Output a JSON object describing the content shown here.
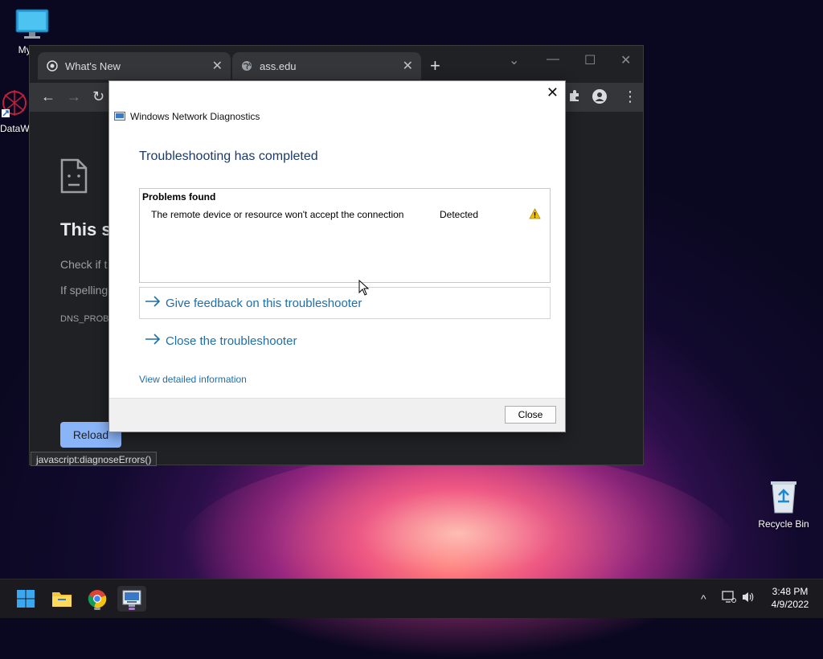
{
  "desktop": {
    "icons": [
      {
        "label": "My Co"
      },
      {
        "label": "DataW"
      },
      {
        "label": "Recycle Bin"
      }
    ]
  },
  "browser": {
    "tabs": [
      {
        "title": "What's New",
        "icon": "chrome-icon"
      },
      {
        "title": "ass.edu",
        "icon": "globe-icon"
      }
    ],
    "page": {
      "title": "This si",
      "line1": "Check if t",
      "line2": "If spelling",
      "code": "DNS_PROB",
      "reload_label": "Reload"
    },
    "status_text": "javascript:diagnoseErrors()"
  },
  "dialog": {
    "title": "Windows Network Diagnostics",
    "heading": "Troubleshooting has completed",
    "problems_header": "Problems found",
    "problems": [
      {
        "description": "The remote device or resource won't accept the connection",
        "status": "Detected",
        "icon": "warning-icon"
      }
    ],
    "links": [
      {
        "label": "Give feedback on this troubleshooter"
      },
      {
        "label": "Close the troubleshooter"
      }
    ],
    "detail_link": "View detailed information",
    "close_button": "Close",
    "colors": {
      "heading": "#1a3a6e",
      "link": "#1f6ea8",
      "warning": "#f2c200"
    }
  },
  "taskbar": {
    "time": "3:48 PM",
    "date": "4/9/2022"
  }
}
